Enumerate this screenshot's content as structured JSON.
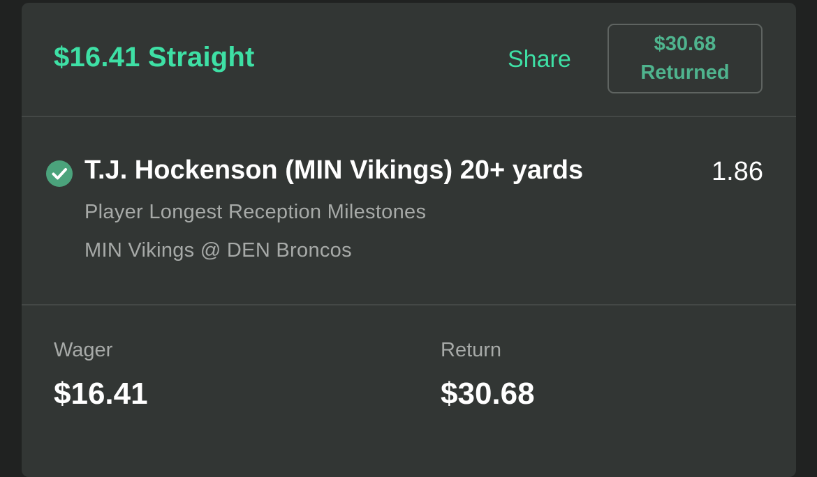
{
  "header": {
    "title": "$16.41 Straight",
    "share_label": "Share",
    "returned_amount": "$30.68",
    "returned_label": "Returned"
  },
  "bet": {
    "status_icon": "check-circle-icon",
    "selection": "T.J. Hockenson (MIN Vikings) 20+ yards",
    "odds": "1.86",
    "market": "Player Longest Reception Milestones",
    "matchup": "MIN Vikings @ DEN Broncos"
  },
  "summary": {
    "wager_label": "Wager",
    "wager_value": "$16.41",
    "return_label": "Return",
    "return_value": "$30.68"
  },
  "colors": {
    "accent": "#3ee0a5",
    "badge_text": "#4fb48e",
    "check": "#4ba37c",
    "card_bg": "#323634",
    "page_bg": "#202221"
  }
}
